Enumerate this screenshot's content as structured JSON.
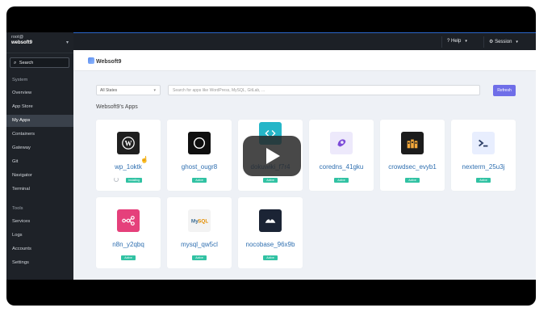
{
  "user": {
    "line1": "root@",
    "line2": "websoft9"
  },
  "search": {
    "label": "Search"
  },
  "sidebar": {
    "items": [
      {
        "label": "System",
        "type": "heading"
      },
      {
        "label": "Overview"
      },
      {
        "label": "App Store"
      },
      {
        "label": "My Apps",
        "active": true
      },
      {
        "label": "Containers"
      },
      {
        "label": "Gateway"
      },
      {
        "label": "Git"
      },
      {
        "label": "Navigator"
      },
      {
        "label": "Terminal"
      },
      {
        "label": "Tools",
        "type": "heading"
      },
      {
        "label": "Services"
      },
      {
        "label": "Logs"
      },
      {
        "label": "Accounts"
      },
      {
        "label": "Settings"
      }
    ]
  },
  "topbar": {
    "help": "Help",
    "session": "Session"
  },
  "brand": {
    "name": "Websoft9"
  },
  "filters": {
    "status_value": "All States",
    "search_placeholder": "Search for apps like WordPress, MySQL, GitLab, ...",
    "refresh": "Refresh"
  },
  "section": {
    "title": "Websoft9's Apps"
  },
  "apps": [
    {
      "name": "wp_1oktk",
      "status": "Installing",
      "icon": "wordpress-icon",
      "color": "#1f1f1f"
    },
    {
      "name": "ghost_ougr8",
      "status": "Active",
      "icon": "ghost-icon",
      "color": "#0f0f0f"
    },
    {
      "name": "dokuwiki_f7r4",
      "status": "Active",
      "icon": "code-icon",
      "color": "#25b6c8"
    },
    {
      "name": "coredns_41gku",
      "status": "Active",
      "icon": "coredns-icon",
      "color": "#ede9fb"
    },
    {
      "name": "crowdsec_evyb1",
      "status": "Active",
      "icon": "crowdsec-icon",
      "color": "#1c1c1c"
    },
    {
      "name": "nexterm_25u3j",
      "status": "Active",
      "icon": "terminal-icon",
      "color": "#e8eefe"
    },
    {
      "name": "n8n_y2qbq",
      "status": "Active",
      "icon": "n8n-icon",
      "color": "#e5407b"
    },
    {
      "name": "mysql_qw5cl",
      "status": "Active",
      "icon": "mysql-icon",
      "color": "#f3f3f3"
    },
    {
      "name": "nocobase_96x9b",
      "status": "Active",
      "icon": "nocobase-icon",
      "color": "#1b2435"
    }
  ],
  "colors": {
    "accent": "#6f6ee8",
    "badge": "#31c2a3",
    "sidebar": "#1e2228"
  }
}
